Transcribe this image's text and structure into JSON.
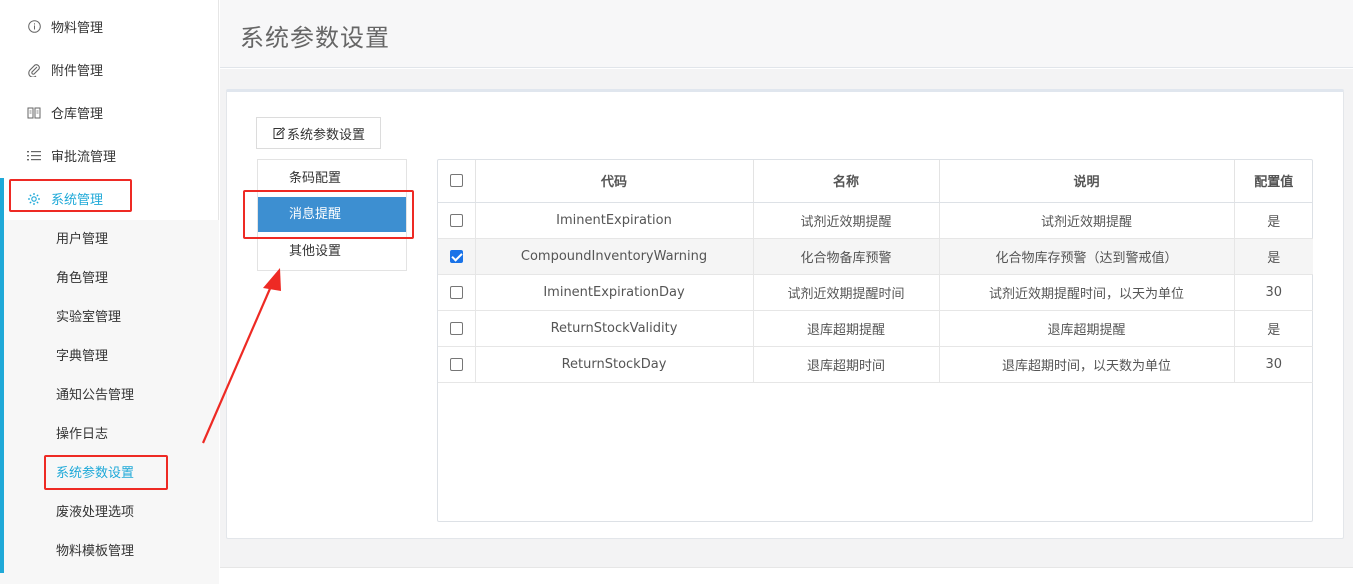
{
  "sidebar": {
    "top_items": [
      {
        "label": "物料管理",
        "icon": "info-circle-icon"
      },
      {
        "label": "附件管理",
        "icon": "paperclip-icon"
      },
      {
        "label": "仓库管理",
        "icon": "book-icon"
      },
      {
        "label": "审批流管理",
        "icon": "list-icon"
      },
      {
        "label": "系统管理",
        "icon": "gear-icon"
      }
    ],
    "sub_items": [
      "用户管理",
      "角色管理",
      "实验室管理",
      "字典管理",
      "通知公告管理",
      "操作日志",
      "系统参数设置",
      "废液处理选项",
      "物料模板管理"
    ],
    "active_sub": "系统参数设置"
  },
  "header": {
    "title": "系统参数设置"
  },
  "tab_button": {
    "label": "系统参数设置",
    "icon": "edit-icon"
  },
  "config_menu": [
    "条码配置",
    "消息提醒",
    "其他设置"
  ],
  "config_active": "消息提醒",
  "table": {
    "columns": [
      "代码",
      "名称",
      "说明",
      "配置值"
    ],
    "rows": [
      {
        "checked": false,
        "code": "IminentExpiration",
        "name": "试剂近效期提醒",
        "desc": "试剂近效期提醒",
        "value": "是"
      },
      {
        "checked": true,
        "code": "CompoundInventoryWarning",
        "name": "化合物备库预警",
        "desc": "化合物库存预警（达到警戒值）",
        "value": "是"
      },
      {
        "checked": false,
        "code": "IminentExpirationDay",
        "name": "试剂近效期提醒时间",
        "desc": "试剂近效期提醒时间，以天为单位",
        "value": "30"
      },
      {
        "checked": false,
        "code": "ReturnStockValidity",
        "name": "退库超期提醒",
        "desc": "退库超期提醒",
        "value": "是"
      },
      {
        "checked": false,
        "code": "ReturnStockDay",
        "name": "退库超期时间",
        "desc": "退库超期时间，以天数为单位",
        "value": "30"
      }
    ]
  },
  "colors": {
    "accent": "#1fa9d8",
    "active_menu": "#3d8fd1",
    "annotation_red": "#ee2a24"
  }
}
